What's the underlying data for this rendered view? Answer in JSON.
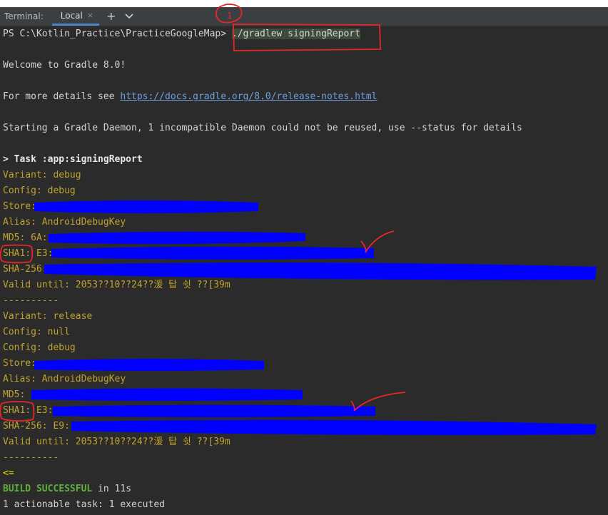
{
  "tabbar": {
    "terminal_label": "Terminal:",
    "tab_local": "Local",
    "close_glyph": "×",
    "add_glyph": "+",
    "chevron_glyph": "⌵"
  },
  "terminal": {
    "prompt": "PS C:\\Kotlin_Practice\\PracticeGoogleMap> ",
    "command": "./gradlew signingReport",
    "welcome": "Welcome to Gradle 8.0!",
    "details_prefix": "For more details see ",
    "details_link": "https://docs.gradle.org/8.0/release-notes.html",
    "daemon": "Starting a Gradle Daemon, 1 incompatible Daemon could not be reused, use --status for details",
    "task": "> Task :app:signingReport",
    "debug": {
      "variant": "Variant: debug",
      "config": "Config: debug",
      "store": "Store: ",
      "alias": "Alias: AndroidDebugKey",
      "md5": "MD5: 6A:",
      "sha1": "SHA1: E3:",
      "sha256": "SHA-256:",
      "valid": "Valid until: 2053??10??24??湲 탑 쉿 ??[39m"
    },
    "separator": "----------",
    "release": {
      "variant": "Variant: release",
      "config_null": "Config: null",
      "config": "Config: debug",
      "store": "Store: ",
      "alias": "Alias: AndroidDebugKey",
      "md5": "MD5: ",
      "sha1": "SHA1: E3:",
      "sha256": "SHA-256: E9:",
      "valid": "Valid until: 2053??10??24??湲 탑 쉿 ??[39m"
    },
    "arrow": "<=",
    "build_status": "BUILD SUCCESSFUL",
    "build_time": " in 11s",
    "tasks_summary": "1 actionable task: 1 executed"
  },
  "annotations": {
    "step_number": "1"
  },
  "colors": {
    "background": "#2b2b2b",
    "tabbar": "#3c3f41",
    "accent_tab": "#4a88c7",
    "output_yellow": "#c0a32e",
    "link": "#6c9ee0",
    "success": "#5faf3c",
    "redaction": "#0000ff",
    "annotation_red": "#e8262a"
  }
}
